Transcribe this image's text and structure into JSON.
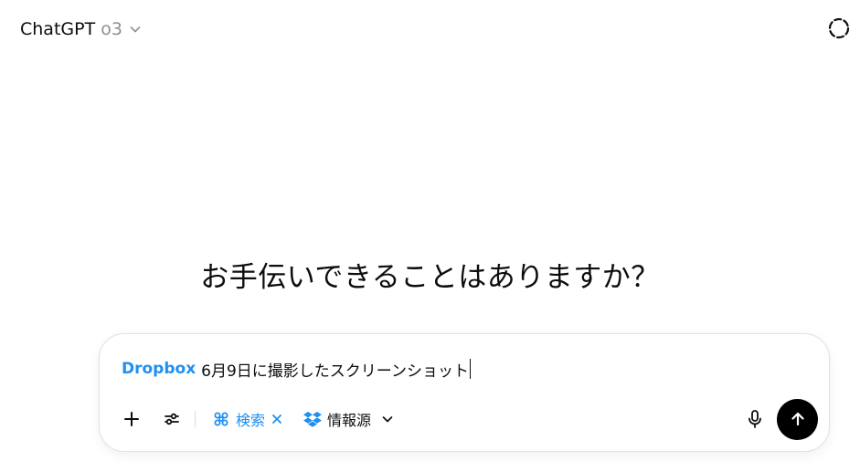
{
  "header": {
    "model_name": "ChatGPT",
    "model_version": "o3",
    "model_switcher_icon": "chevron-down-icon",
    "temporary_chat_icon": "dashed-circle-icon"
  },
  "main": {
    "headline": "お手伝いできることはありますか？"
  },
  "composer": {
    "connector_tag": "Dropbox",
    "input_text": "6月9日に撮影したスクリーンショット",
    "toolbar": {
      "add_icon": "plus-icon",
      "tools_icon": "sliders-icon",
      "search_label": "検索",
      "search_icon": "command-icon",
      "search_remove_icon": "close-icon",
      "sources_label": "情報源",
      "sources_icon": "dropbox-icon",
      "sources_chevron": "chevron-down-icon",
      "mic_icon": "microphone-icon",
      "send_icon": "arrow-up-icon"
    }
  },
  "colors": {
    "accent": "#1f8ff0",
    "text": "#0d0d0d",
    "muted": "#8f8f8f",
    "send_bg": "#000000"
  }
}
